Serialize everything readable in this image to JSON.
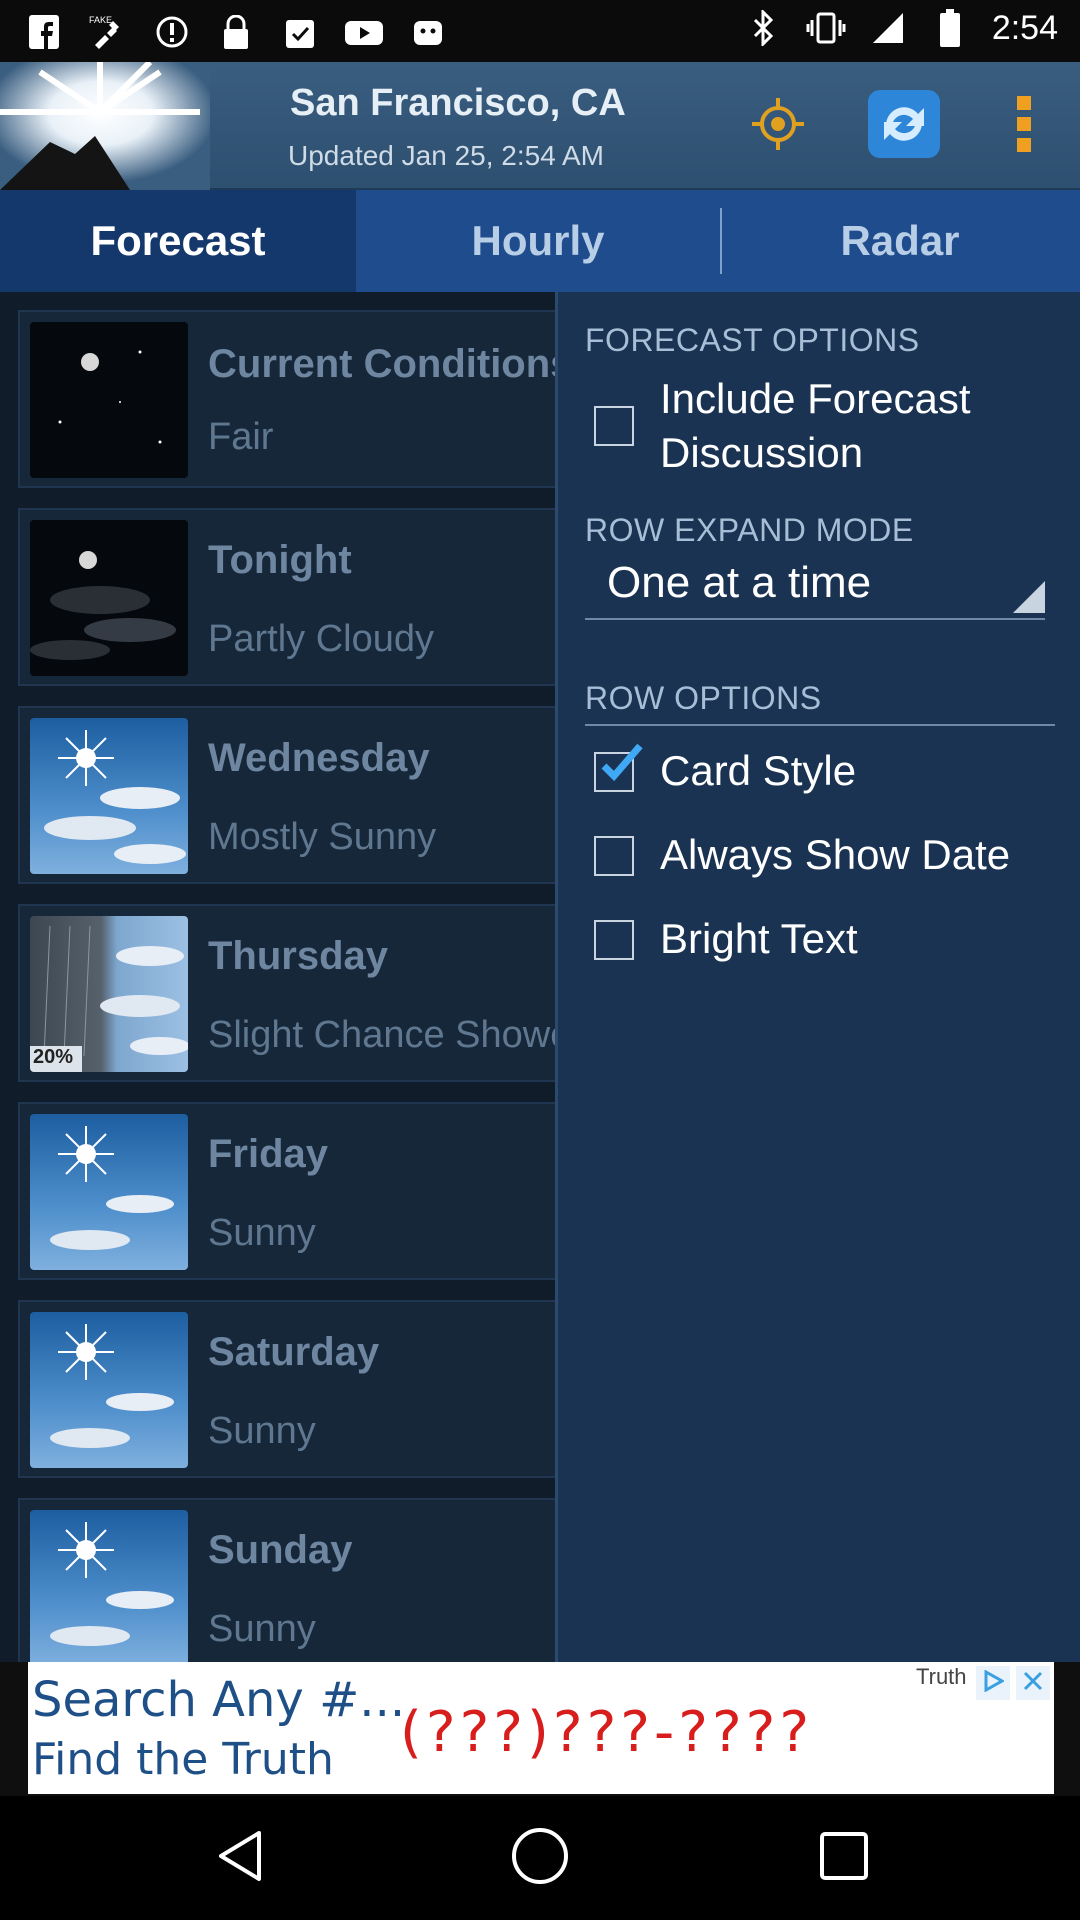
{
  "status_bar": {
    "time": "2:54",
    "left_icons": [
      "facebook-icon",
      "fake-gps-icon",
      "alert-icon",
      "lock-icon",
      "clipboard-icon",
      "youtube-icon",
      "android-icon"
    ],
    "right_icons": [
      "bluetooth-icon",
      "vibrate-icon",
      "signal-icon",
      "battery-icon"
    ]
  },
  "header": {
    "location": "San Francisco, CA",
    "updated": "Updated Jan 25, 2:54 AM"
  },
  "tabs": [
    {
      "label": "Forecast",
      "active": true
    },
    {
      "label": "Hourly",
      "active": false
    },
    {
      "label": "Radar",
      "active": false
    }
  ],
  "forecast": [
    {
      "day": "Current Conditions",
      "condition": "Fair",
      "icon": "night-clear"
    },
    {
      "day": "Tonight",
      "condition": "Partly Cloudy",
      "icon": "night-cloudy"
    },
    {
      "day": "Wednesday",
      "condition": "Mostly Sunny",
      "icon": "sunny-clouds"
    },
    {
      "day": "Thursday",
      "condition": "Slight Chance Showers",
      "icon": "showers",
      "precip": "20%"
    },
    {
      "day": "Friday",
      "condition": "Sunny",
      "icon": "sunny"
    },
    {
      "day": "Saturday",
      "condition": "Sunny",
      "icon": "sunny"
    },
    {
      "day": "Sunday",
      "condition": "Sunny",
      "icon": "sunny"
    }
  ],
  "options": {
    "forecast_options_title": "FORECAST OPTIONS",
    "include_discussion_line1": "Include Forecast",
    "include_discussion_line2": "Discussion",
    "include_discussion_checked": false,
    "row_expand_title": "ROW EXPAND MODE",
    "row_expand_value": "One at a time",
    "row_options_title": "ROW OPTIONS",
    "card_style": "Card Style",
    "card_style_checked": true,
    "always_show_date": "Always Show Date",
    "always_show_date_checked": false,
    "bright_text": "Bright Text",
    "bright_text_checked": false
  },
  "ad": {
    "line1": "Search Any #...",
    "line2": "Find the Truth",
    "number": "(???)???-????",
    "brand": "Truth"
  },
  "colors": {
    "accent_blue": "#1f4c8c",
    "panel_bg": "#1a3352",
    "check_blue": "#3fa9f5",
    "ad_red": "#d81d1d"
  }
}
